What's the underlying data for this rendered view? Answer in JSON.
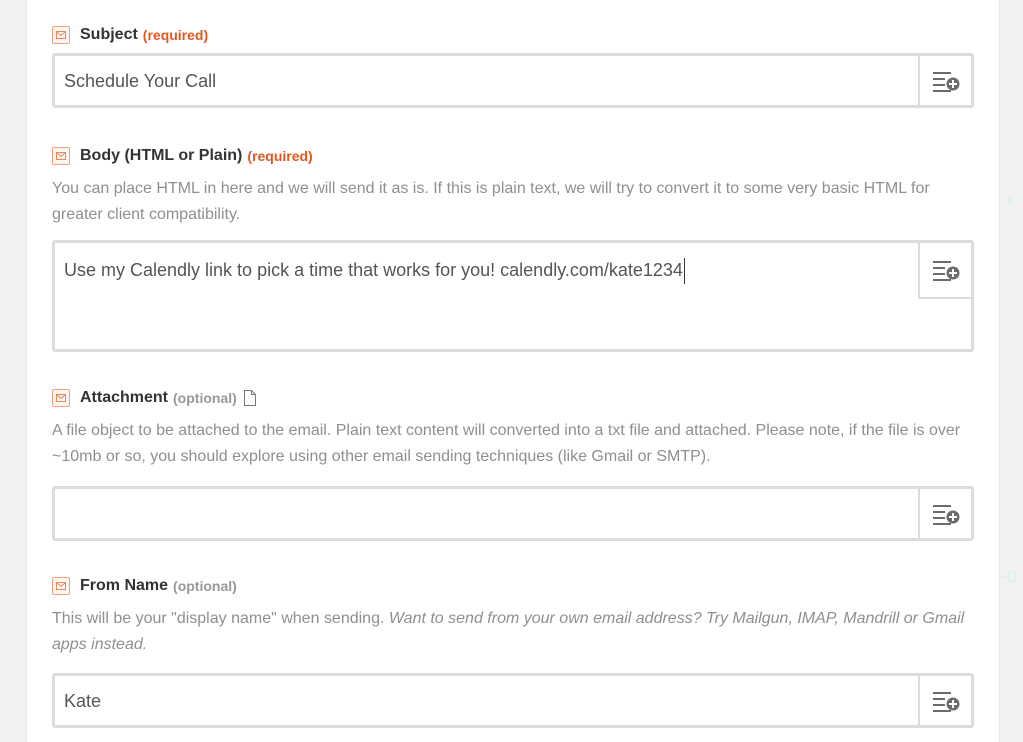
{
  "colors": {
    "accent_required": "#e0581f",
    "optional": "#999999",
    "icon_border": "#f0a27f",
    "input_border": "#dcdcdc"
  },
  "fields": {
    "subject": {
      "label": "Subject",
      "tag": "(required)",
      "value": "Schedule Your Call",
      "icon": "mail-icon",
      "action_icon": "insert-field-icon"
    },
    "body": {
      "label": "Body (HTML or Plain)",
      "tag": "(required)",
      "help": "You can place HTML in here and we will send it as is. If this is plain text, we will try to convert it to some very basic HTML for greater client compatibility.",
      "value": "Use my Calendly link to pick a time that works for you! calendly.com/kate1234",
      "icon": "mail-icon",
      "action_icon": "insert-field-icon"
    },
    "attachment": {
      "label": "Attachment",
      "tag": "(optional)",
      "help": "A file object to be attached to the email. Plain text content will converted into a txt file and attached. Please note, if the file is over ~10mb or so, you should explore using other email sending techniques (like Gmail or SMTP).",
      "value": "",
      "icon": "mail-icon",
      "extra_icon": "file-icon",
      "action_icon": "insert-field-icon"
    },
    "from_name": {
      "label": "From Name",
      "tag": "(optional)",
      "help_plain": "This will be your \"display name\" when sending. ",
      "help_italic": "Want to send from your own email address? Try Mailgun, IMAP, Mandrill or Gmail apps instead.",
      "value": "Kate",
      "icon": "mail-icon",
      "action_icon": "insert-field-icon"
    }
  }
}
